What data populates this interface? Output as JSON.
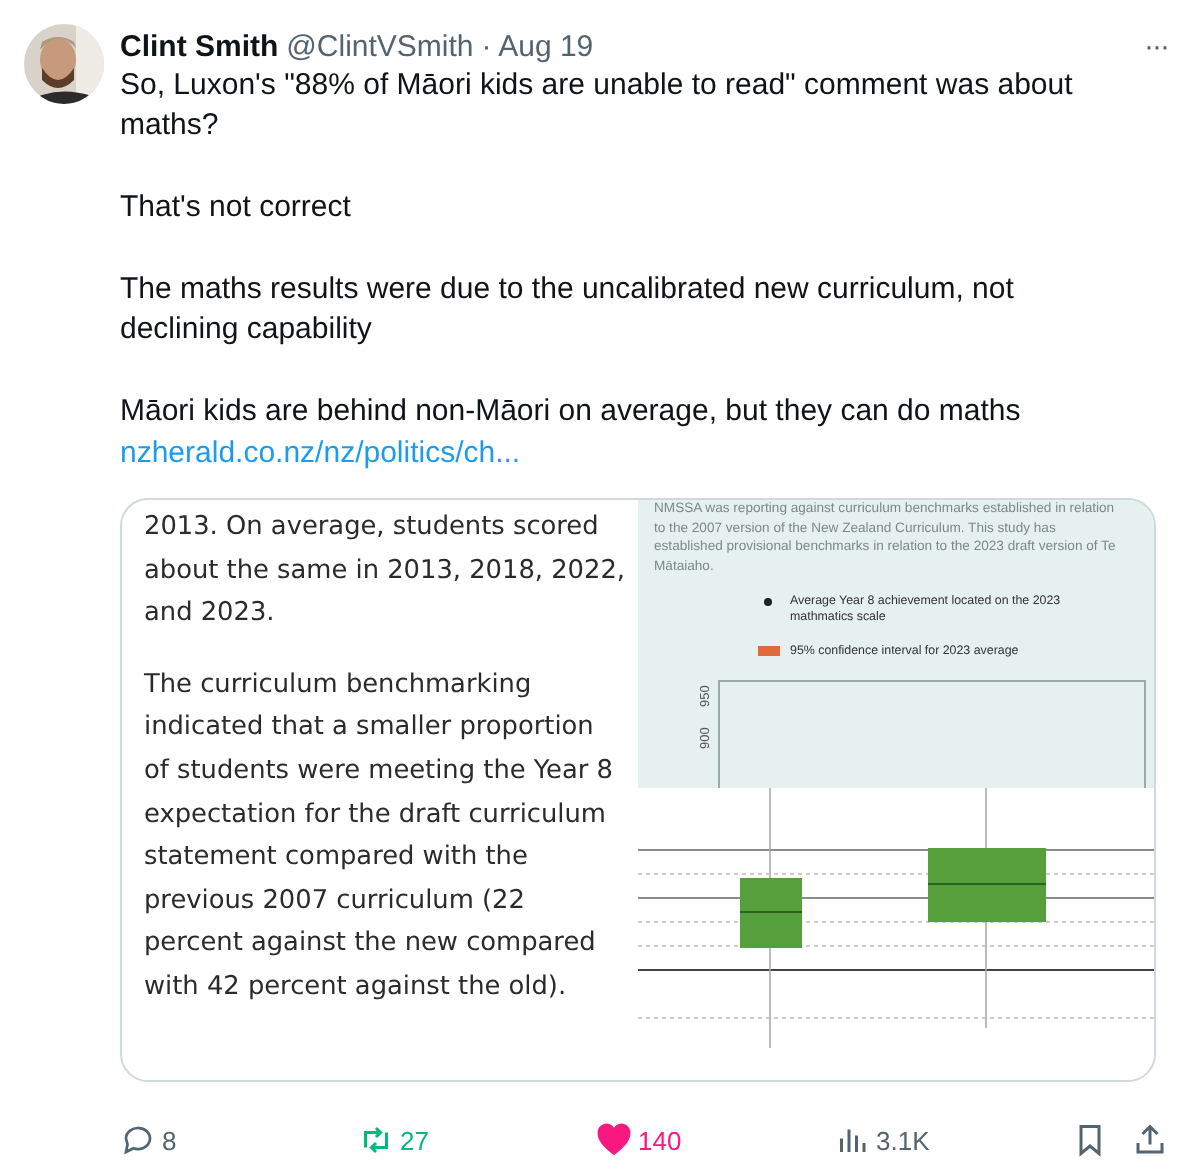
{
  "author": {
    "name": "Clint Smith",
    "handle": "@ClintVSmith",
    "date": "· Aug 19"
  },
  "more_icon": "···",
  "paragraphs": [
    "So, Luxon's \"88% of Māori kids are unable to read\" comment was about maths?",
    "That's not correct",
    "The maths results were due to the uncalibrated new curriculum, not declining capability",
    "Māori kids are behind non-Māori on average, but they can do maths"
  ],
  "link": "nzherald.co.nz/nz/politics/ch...",
  "image": {
    "paragraphs": [
      "2013. On average, students scored about the same in 2013, 2018, 2022, and 2023.",
      "The curriculum benchmarking indicated that a smaller proportion of students were meeting the Year 8 expectation for the draft curriculum statement compared with the previous 2007 curriculum (22 percent against the new compared with 42 percent against the old)."
    ],
    "caption": "NMSSA was reporting against curriculum benchmarks established in relation to the 2007 version of the New Zealand Curriculum. This study has established provisional benchmarks in relation to the 2023 draft version of Te Mātaiaho.",
    "legend": [
      {
        "kind": "dot",
        "label": "Average Year 8 achievement located on the 2023 mathmatics scale",
        "color": "#222222"
      },
      {
        "kind": "swatch",
        "label": "95% confidence interval for 2023 average",
        "color": "#e06a3c"
      }
    ],
    "axis_ticks": [
      "950",
      "900"
    ]
  },
  "actions": [
    {
      "kind": "reply",
      "count": "8",
      "selected": false
    },
    {
      "kind": "retweet",
      "count": "27",
      "selected": true
    },
    {
      "kind": "like",
      "count": "140",
      "selected": true
    },
    {
      "kind": "views",
      "count": "3.1K",
      "selected": false
    }
  ]
}
